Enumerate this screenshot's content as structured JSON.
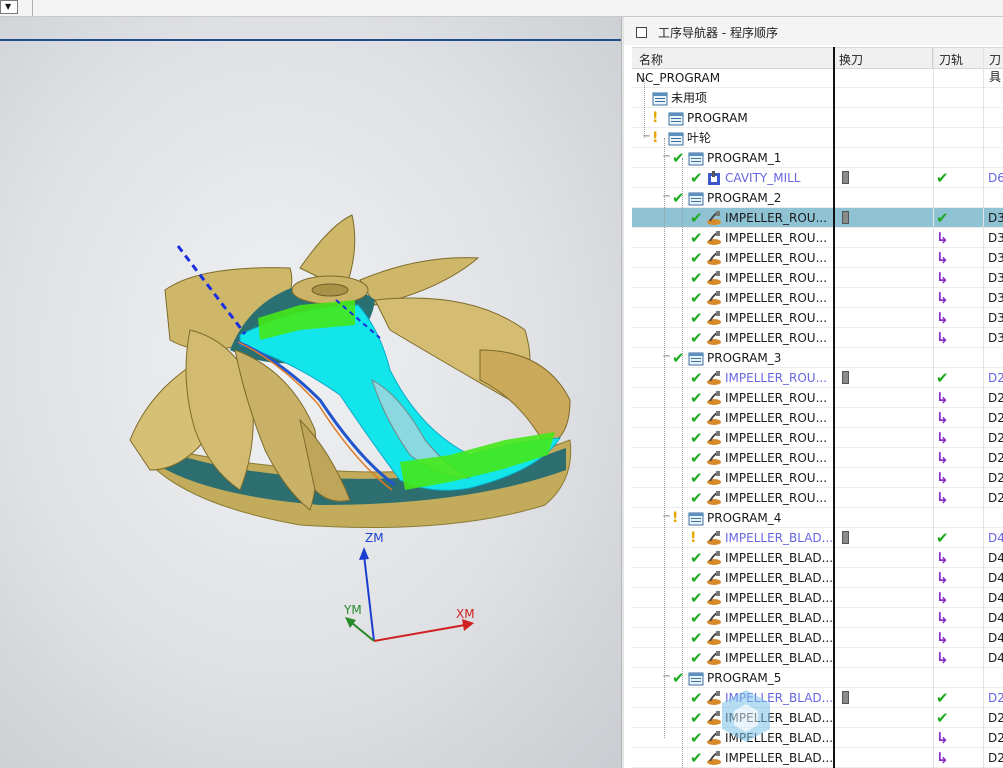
{
  "navigator": {
    "title": "工序导航器 - 程序顺序",
    "columns": [
      "名称",
      "换刀",
      "刀轨",
      "刀具"
    ]
  },
  "rows": [
    {
      "name": "NC_PROGRAM",
      "level": 0,
      "type": "root",
      "status": "",
      "tool": false,
      "path": "",
      "knife": "",
      "blue": false,
      "selected": false
    },
    {
      "name": "未用项",
      "level": 1,
      "type": "group",
      "status": "",
      "tool": false,
      "path": "",
      "knife": "",
      "blue": false,
      "selected": false
    },
    {
      "name": "PROGRAM",
      "level": 1,
      "type": "group",
      "status": "warn",
      "tool": false,
      "path": "",
      "knife": "",
      "blue": false,
      "selected": false
    },
    {
      "name": "叶轮",
      "level": 1,
      "type": "group",
      "status": "warn",
      "tool": false,
      "path": "",
      "knife": "",
      "blue": false,
      "selected": false,
      "expand": "-"
    },
    {
      "name": "PROGRAM_1",
      "level": 2,
      "type": "group",
      "status": "ok",
      "tool": false,
      "path": "",
      "knife": "",
      "blue": false,
      "selected": false,
      "expand": "-"
    },
    {
      "name": "CAVITY_MILL",
      "level": 3,
      "type": "cavity",
      "status": "ok",
      "tool": true,
      "path": "ok",
      "knife": "D6",
      "blue": true,
      "selected": false
    },
    {
      "name": "PROGRAM_2",
      "level": 2,
      "type": "group",
      "status": "ok",
      "tool": false,
      "path": "",
      "knife": "",
      "blue": false,
      "selected": false,
      "expand": "-"
    },
    {
      "name": "IMPELLER_ROU...",
      "level": 3,
      "type": "op",
      "status": "ok",
      "tool": true,
      "path": "ok",
      "knife": "D3",
      "blue": false,
      "selected": true
    },
    {
      "name": "IMPELLER_ROU...",
      "level": 3,
      "type": "op",
      "status": "ok",
      "tool": false,
      "path": "regen",
      "knife": "D3",
      "blue": false,
      "selected": false
    },
    {
      "name": "IMPELLER_ROU...",
      "level": 3,
      "type": "op",
      "status": "ok",
      "tool": false,
      "path": "regen",
      "knife": "D3",
      "blue": false,
      "selected": false
    },
    {
      "name": "IMPELLER_ROU...",
      "level": 3,
      "type": "op",
      "status": "ok",
      "tool": false,
      "path": "regen",
      "knife": "D3",
      "blue": false,
      "selected": false
    },
    {
      "name": "IMPELLER_ROU...",
      "level": 3,
      "type": "op",
      "status": "ok",
      "tool": false,
      "path": "regen",
      "knife": "D3",
      "blue": false,
      "selected": false
    },
    {
      "name": "IMPELLER_ROU...",
      "level": 3,
      "type": "op",
      "status": "ok",
      "tool": false,
      "path": "regen",
      "knife": "D3",
      "blue": false,
      "selected": false
    },
    {
      "name": "IMPELLER_ROU...",
      "level": 3,
      "type": "op",
      "status": "ok",
      "tool": false,
      "path": "regen",
      "knife": "D3",
      "blue": false,
      "selected": false
    },
    {
      "name": "PROGRAM_3",
      "level": 2,
      "type": "group",
      "status": "ok",
      "tool": false,
      "path": "",
      "knife": "",
      "blue": false,
      "selected": false,
      "expand": "-"
    },
    {
      "name": "IMPELLER_ROU...",
      "level": 3,
      "type": "op",
      "status": "ok",
      "tool": true,
      "path": "ok",
      "knife": "D2",
      "blue": true,
      "selected": false
    },
    {
      "name": "IMPELLER_ROU...",
      "level": 3,
      "type": "op",
      "status": "ok",
      "tool": false,
      "path": "regen",
      "knife": "D2",
      "blue": false,
      "selected": false
    },
    {
      "name": "IMPELLER_ROU...",
      "level": 3,
      "type": "op",
      "status": "ok",
      "tool": false,
      "path": "regen",
      "knife": "D2",
      "blue": false,
      "selected": false
    },
    {
      "name": "IMPELLER_ROU...",
      "level": 3,
      "type": "op",
      "status": "ok",
      "tool": false,
      "path": "regen",
      "knife": "D2",
      "blue": false,
      "selected": false
    },
    {
      "name": "IMPELLER_ROU...",
      "level": 3,
      "type": "op",
      "status": "ok",
      "tool": false,
      "path": "regen",
      "knife": "D2",
      "blue": false,
      "selected": false
    },
    {
      "name": "IMPELLER_ROU...",
      "level": 3,
      "type": "op",
      "status": "ok",
      "tool": false,
      "path": "regen",
      "knife": "D2",
      "blue": false,
      "selected": false
    },
    {
      "name": "IMPELLER_ROU...",
      "level": 3,
      "type": "op",
      "status": "ok",
      "tool": false,
      "path": "regen",
      "knife": "D2",
      "blue": false,
      "selected": false
    },
    {
      "name": "PROGRAM_4",
      "level": 2,
      "type": "group",
      "status": "warn",
      "tool": false,
      "path": "",
      "knife": "",
      "blue": false,
      "selected": false,
      "expand": "-"
    },
    {
      "name": "IMPELLER_BLAD...",
      "level": 3,
      "type": "op",
      "status": "warn",
      "tool": true,
      "path": "ok",
      "knife": "D4",
      "blue": true,
      "selected": false
    },
    {
      "name": "IMPELLER_BLAD...",
      "level": 3,
      "type": "op",
      "status": "ok",
      "tool": false,
      "path": "regen",
      "knife": "D4",
      "blue": false,
      "selected": false
    },
    {
      "name": "IMPELLER_BLAD...",
      "level": 3,
      "type": "op",
      "status": "ok",
      "tool": false,
      "path": "regen",
      "knife": "D4",
      "blue": false,
      "selected": false
    },
    {
      "name": "IMPELLER_BLAD...",
      "level": 3,
      "type": "op",
      "status": "ok",
      "tool": false,
      "path": "regen",
      "knife": "D4",
      "blue": false,
      "selected": false
    },
    {
      "name": "IMPELLER_BLAD...",
      "level": 3,
      "type": "op",
      "status": "ok",
      "tool": false,
      "path": "regen",
      "knife": "D4",
      "blue": false,
      "selected": false
    },
    {
      "name": "IMPELLER_BLAD...",
      "level": 3,
      "type": "op",
      "status": "ok",
      "tool": false,
      "path": "regen",
      "knife": "D4",
      "blue": false,
      "selected": false
    },
    {
      "name": "IMPELLER_BLAD...",
      "level": 3,
      "type": "op",
      "status": "ok",
      "tool": false,
      "path": "regen",
      "knife": "D4",
      "blue": false,
      "selected": false
    },
    {
      "name": "PROGRAM_5",
      "level": 2,
      "type": "group",
      "status": "ok",
      "tool": false,
      "path": "",
      "knife": "",
      "blue": false,
      "selected": false,
      "expand": "-"
    },
    {
      "name": "IMPELLER_BLAD...",
      "level": 3,
      "type": "op",
      "status": "ok",
      "tool": true,
      "path": "ok",
      "knife": "D2",
      "blue": true,
      "selected": false
    },
    {
      "name": "IMPELLER_BLAD...",
      "level": 3,
      "type": "op",
      "status": "ok",
      "tool": false,
      "path": "ok",
      "knife": "D2",
      "blue": false,
      "selected": false
    },
    {
      "name": "IMPELLER_BLAD...",
      "level": 3,
      "type": "op",
      "status": "ok",
      "tool": false,
      "path": "regen",
      "knife": "D2",
      "blue": false,
      "selected": false
    },
    {
      "name": "IMPELLER_BLAD...",
      "level": 3,
      "type": "op",
      "status": "ok",
      "tool": false,
      "path": "regen",
      "knife": "D2",
      "blue": false,
      "selected": false
    }
  ],
  "viewport": {
    "axes": {
      "z": "ZM",
      "y": "YM",
      "x": "XM"
    },
    "colors": {
      "part": "#c9b46a",
      "hub": "#2a6f72",
      "toolpath": "#00e5e5",
      "green": "#33dd11",
      "axis_z": "#1a3fd0",
      "axis_x": "#d02020",
      "axis_y": "#2a8a2a"
    }
  }
}
